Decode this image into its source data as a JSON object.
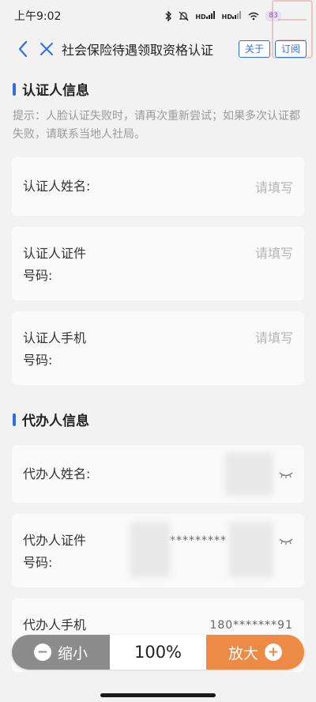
{
  "status_bar": {
    "time": "上午9:02",
    "icons": [
      "bluetooth-icon",
      "mute-icon",
      "hd-signal-icon",
      "hd-signal-icon",
      "wifi-icon"
    ],
    "hd_label": "HD",
    "battery": "83"
  },
  "nav": {
    "title": "社会保险待遇领取资格认证",
    "about_label": "关于",
    "subscribe_label": "订阅",
    "accent_color": "#2f6fe4"
  },
  "certifier_section": {
    "title": "认证人信息",
    "hint": "提示：人脸认证失败时，请再次重新尝试；如果多次认证都失败，请联系当地人社局。",
    "fields": [
      {
        "label": "认证人姓名:",
        "placeholder": "请填写"
      },
      {
        "label_line1": "认证人证件",
        "label_line2": "号码:",
        "placeholder": "请填写"
      },
      {
        "label_line1": "认证人手机",
        "label_line2": "号码:",
        "placeholder": "请填写"
      }
    ]
  },
  "agent_section": {
    "title": "代办人信息",
    "fields": [
      {
        "label": "代办人姓名:",
        "value": ""
      },
      {
        "label_line1": "代办人证件",
        "label_line2": "号码:",
        "value": "*********"
      },
      {
        "label": "代办人手机",
        "value": "180*******91"
      }
    ]
  },
  "zoom": {
    "out_label": "缩小",
    "level": "100%",
    "in_label": "放大",
    "out_color": "#8c8c8c",
    "in_color": "#ec8a46"
  }
}
